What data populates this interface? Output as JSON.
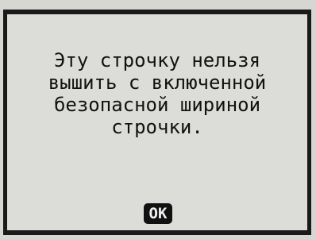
{
  "dialog": {
    "message_lines": [
      "Эту строчку нельзя",
      "вышить с включенной",
      "безопасной шириной",
      "строчки."
    ],
    "ok_label": "OK"
  }
}
